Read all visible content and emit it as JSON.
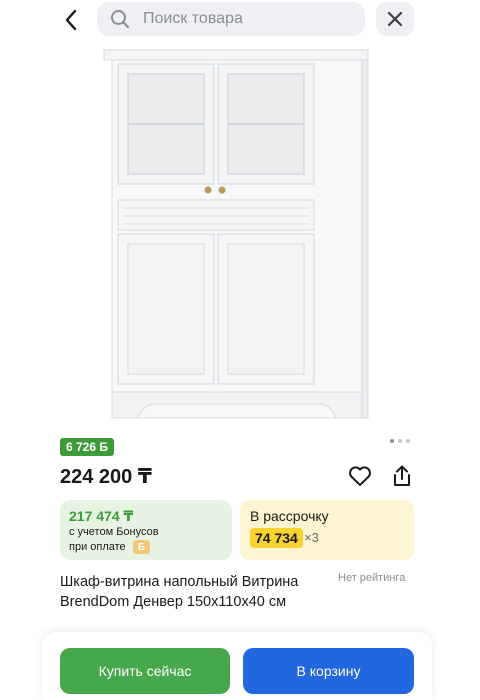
{
  "header": {
    "search_placeholder": "Поиск товара"
  },
  "icons": {
    "back": "chevron-left-icon",
    "search": "search-icon",
    "close": "close-icon",
    "favorite": "heart-icon",
    "share": "share-icon"
  },
  "gallery": {
    "image_count": 3,
    "active_index": 0
  },
  "product": {
    "bonus_badge": "6 726 Б",
    "price": "224 200 ₸",
    "title": "Шкаф-витрина напольный Витрина BrendDom Денвер 150x110x40 см",
    "rating_text": "Нет рейтинга"
  },
  "bonus_card": {
    "amount": "217 474 ₸",
    "note_line1": "с учетом Бонусов",
    "note_line2": "при оплате",
    "chip": "Б"
  },
  "installment_card": {
    "title": "В рассрочку",
    "monthly": "74 734",
    "multiplier": "×3"
  },
  "actions": {
    "buy_now": "Купить сейчас",
    "add_to_cart": "В корзину"
  },
  "colors": {
    "green": "#46a84a",
    "blue": "#2266e0",
    "yellow": "#f8d22e",
    "bonus_green": "#3f9a3c"
  }
}
